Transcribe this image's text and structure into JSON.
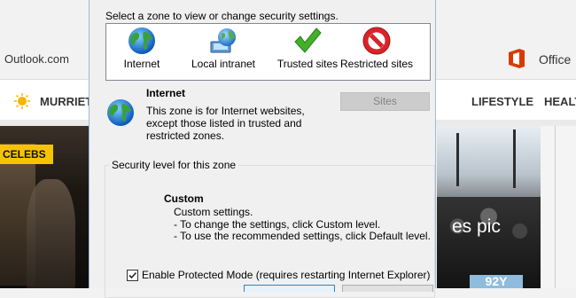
{
  "background_page": {
    "outlook_link": "Outlook.com",
    "office_link": "Office",
    "weather_city": "MURRIETA",
    "nav_items": [
      "LIFESTYLE",
      "HEALTH"
    ],
    "celebs_badge": "CELEBS",
    "photo_caption": "es pic",
    "badge_text": "92Y"
  },
  "dialog": {
    "prompt": "Select a zone to view or change security settings.",
    "zones": [
      {
        "label": "Internet",
        "icon": "globe-icon"
      },
      {
        "label": "Local intranet",
        "icon": "network-globe-icon"
      },
      {
        "label": "Trusted sites",
        "icon": "checkmark-icon"
      },
      {
        "label": "Restricted sites",
        "icon": "no-entry-icon"
      }
    ],
    "selected_zone": {
      "title": "Internet",
      "description": "This zone is for Internet websites, except those listed in trusted and restricted zones."
    },
    "sites_button": "Sites",
    "security_level": {
      "group_title": "Security level for this zone",
      "level_name": "Custom",
      "lines": [
        "Custom settings.",
        "- To change the settings, click Custom level.",
        "- To use the recommended settings, click Default level."
      ]
    },
    "protected_mode": {
      "label": "Enable Protected Mode (requires restarting Internet Explorer)",
      "checked": true
    }
  },
  "colors": {
    "accent": "#3c7fb1",
    "celebs_badge": "#f5c400",
    "office_red": "#d83b01"
  }
}
